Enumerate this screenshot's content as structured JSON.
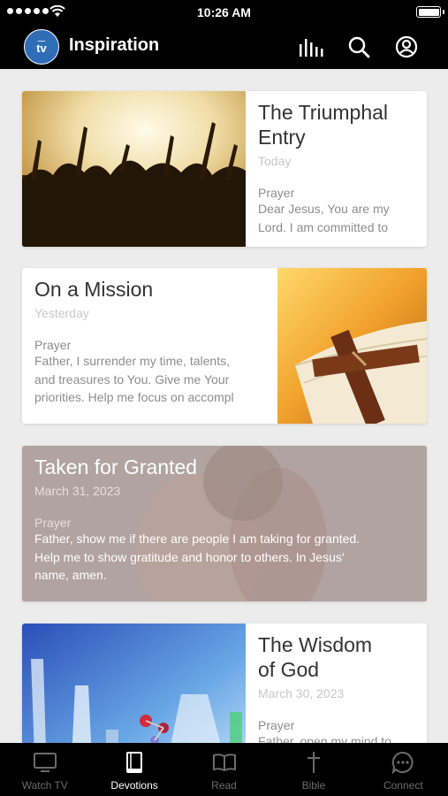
{
  "status_bar": {
    "time": "10:26 AM"
  },
  "header": {
    "logo_text": "tv",
    "title": "Inspiration"
  },
  "cards": [
    {
      "title": "The Triumphal Entry",
      "date": "Today",
      "label": "Prayer",
      "body": [
        "Dear Jesus, You are my",
        "Lord. I am committed to"
      ]
    },
    {
      "title": "On a Mission",
      "date": "Yesterday",
      "label": "Prayer",
      "body": [
        "Father, I surrender my time, talents,",
        "and treasures to You. Give me Your",
        "priorities. Help me focus on accompl"
      ]
    },
    {
      "title": "Taken for Granted",
      "date": "March 31, 2023",
      "label": "Prayer",
      "body": [
        "Father, show me if there are people I am taking for granted.",
        "Help me to show gratitude and honor to others. In Jesus'",
        "name, amen."
      ]
    },
    {
      "title_lines": [
        "The Wisdom",
        "of God"
      ],
      "date": "March 30, 2023",
      "label": "Prayer",
      "body": [
        "Father, open my mind to"
      ]
    }
  ],
  "tabs": [
    {
      "label": "Watch TV",
      "icon": "tv-icon"
    },
    {
      "label": "Devotions",
      "icon": "book-icon"
    },
    {
      "label": "Read",
      "icon": "open-book-icon"
    },
    {
      "label": "Bible",
      "icon": "cross-icon"
    },
    {
      "label": "Connect",
      "icon": "chat-icon"
    }
  ],
  "active_tab": "Devotions",
  "colors": {
    "header_bg": "#000000",
    "logo_bg": "#2f6db7",
    "background": "#ececec",
    "active_tab": "#ffffff",
    "inactive_tab": "#6b6b6b"
  }
}
